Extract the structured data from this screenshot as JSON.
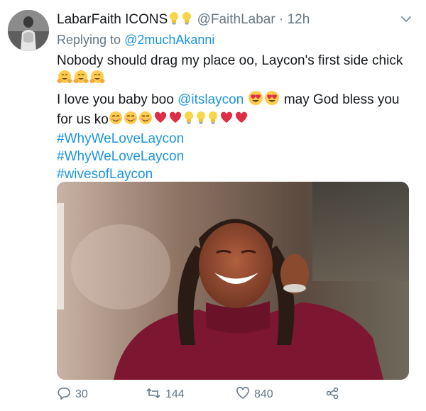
{
  "tweet": {
    "display_name": "LabarFaith ICONS",
    "handle": "@FaithLabar",
    "separator": "·",
    "time": "12h",
    "replying_prefix": "Replying to",
    "replying_to": "@2muchAkanni",
    "line1": "Nobody should drag my place oo, Laycon's first side chick",
    "line3_prefix": "I love you baby boo",
    "mention": "@itslaycon",
    "line3_suffix": "may God bless you",
    "line4_prefix": "for us ko",
    "hashtags": [
      "#WhyWeLoveLaycon",
      "#WhyWeLoveLaycon",
      "#wivesofLaycon"
    ]
  },
  "icons": {
    "bulbs": [
      "lightbulb-icon",
      "lightbulb-icon"
    ],
    "line2_emojis": [
      "hugging-face-icon",
      "hugging-face-icon",
      "hugging-face-icon"
    ],
    "line3_emojis": [
      "heart-eyes-icon",
      "heart-eyes-icon"
    ],
    "line4_emojis": [
      "smiling-blush-icon",
      "smiling-blush-icon",
      "smiling-blush-icon",
      "red-heart-icon",
      "red-heart-icon",
      "lightbulb-icon",
      "lightbulb-icon",
      "lightbulb-icon",
      "red-heart-icon",
      "red-heart-icon"
    ]
  },
  "actions": {
    "replies": "30",
    "retweets": "144",
    "likes": "840"
  },
  "colors": {
    "link": "#1b95e0",
    "muted": "#657786",
    "text": "#14171a",
    "heart": "#dd2e44",
    "photo_shirt": "#7d1630"
  }
}
